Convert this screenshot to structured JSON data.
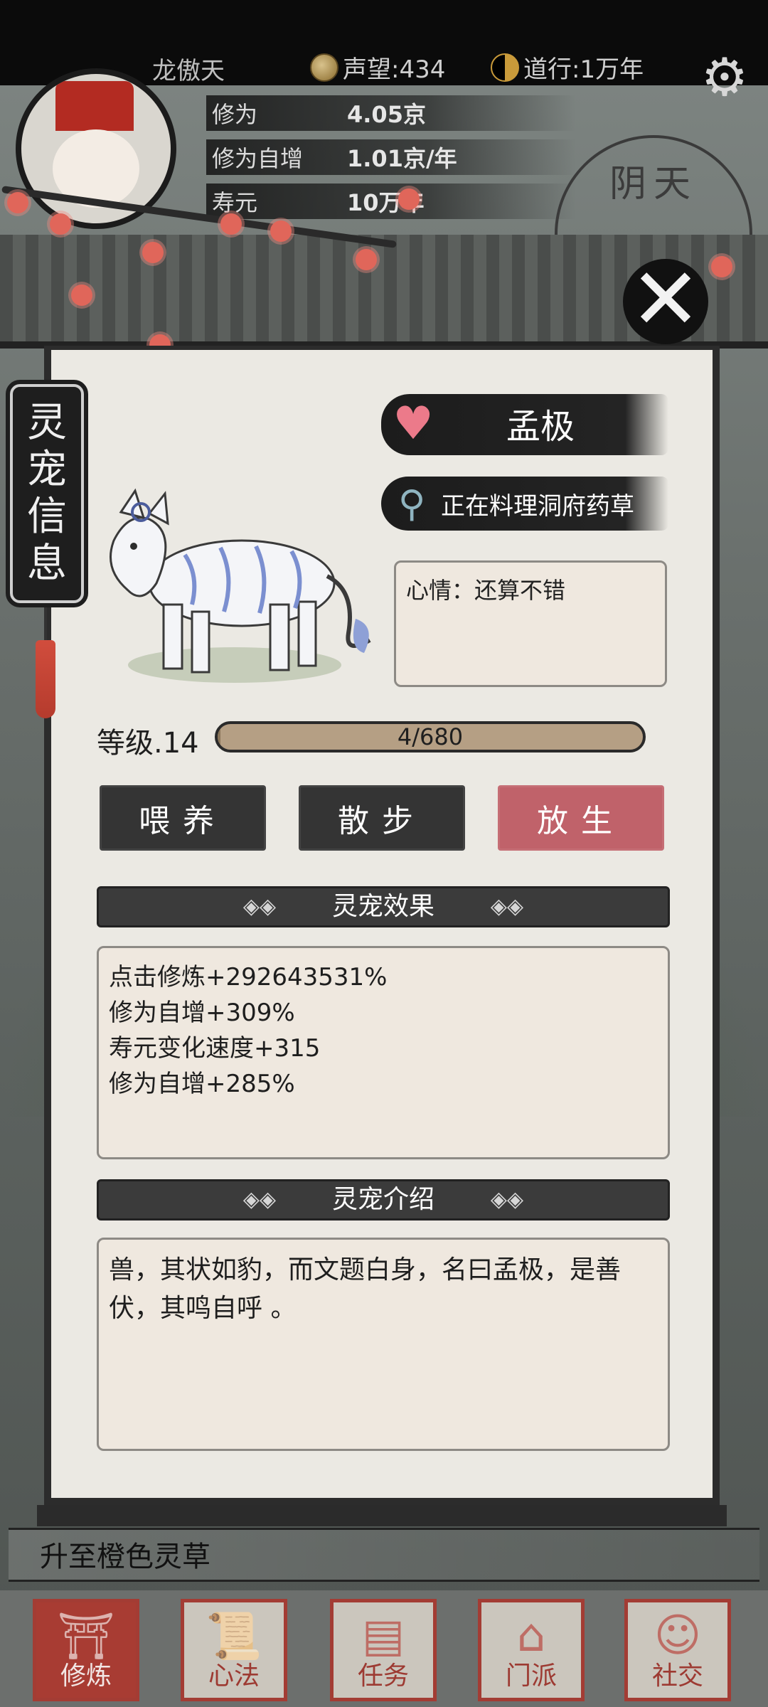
{
  "header": {
    "player_name": "龙傲天",
    "prestige_label": "声望:434",
    "dao_label": "道行:1万年"
  },
  "stats": {
    "cultivation_label": "修为",
    "cultivation_value": "4.05京",
    "auto_gain_label": "修为自增",
    "auto_gain_value": "1.01京/年",
    "lifespan_label": "寿元",
    "lifespan_value": "10万年"
  },
  "weather": "阴天",
  "side_tag": [
    "灵",
    "宠",
    "信",
    "息"
  ],
  "pet": {
    "name": "孟极",
    "location": "正在料理洞府药草",
    "mood": "心情：还算不错",
    "level_label": "等级.14",
    "xp_text": "4/680",
    "xp_fraction": 0.006
  },
  "actions": {
    "feed": "喂养",
    "walk": "散步",
    "release": "放生"
  },
  "effects": {
    "title": "灵宠效果",
    "lines": [
      "点击修炼+292643531%",
      "修为自增+309%",
      "寿元变化速度+315",
      "修为自增+285%"
    ]
  },
  "intro": {
    "title": "灵宠介绍",
    "text": "兽，其状如豹，而文题白身，名曰孟极，是善伏，其鸣自呼 。"
  },
  "notice": "升至橙色灵草",
  "nav": [
    {
      "label": "修炼"
    },
    {
      "label": "心法"
    },
    {
      "label": "任务"
    },
    {
      "label": "门派"
    },
    {
      "label": "社交"
    }
  ],
  "colors": {
    "release_button": "#c0626a",
    "accent_red": "#a83c33",
    "heart": "#ec7a8a"
  }
}
